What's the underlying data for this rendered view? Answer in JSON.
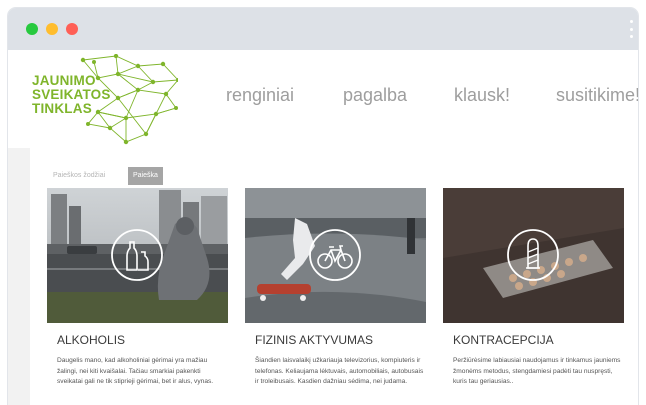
{
  "logo": {
    "line1": "JAUNIMO",
    "line2": "SVEIKATOS",
    "line3": "TINKLAS",
    "color": "#7fb52b"
  },
  "nav": {
    "items": [
      {
        "label": "renginiai"
      },
      {
        "label": "pagalba"
      },
      {
        "label": "klausk!"
      },
      {
        "label": "susitikime!"
      }
    ]
  },
  "tabs": [
    {
      "label": "Paieškos žodžiai",
      "active": false
    },
    {
      "label": "Paieška",
      "active": true
    }
  ],
  "cards": [
    {
      "title": "ALKOHOLIS",
      "icon": "bottles-icon",
      "text": "Daugelis mano, kad alkoholiniai gėrimai yra mažiau žalingi, nei kiti kvaišalai. Tačiau smarkiai pakenkti sveikatai gali ne tik stiprieji gėrimai, bet ir alus, vynas."
    },
    {
      "title": "FIZINIS AKTYVUMAS",
      "icon": "bicycle-icon",
      "text": "Šiandien laisvalaikį užkariauja televizorius, kompiuteris ir telefonas. Keliaujama lėktuvais, automobiliais, autobusais ir troleibusais. Kasdien dažniau sėdima, nei judama."
    },
    {
      "title": "KONTRACEPCIJA",
      "icon": "condom-icon",
      "text": "Peržiūrėsime labiausiai naudojamus ir tinkamus jauniems žmonėms metodus, stengdamiesi padėti tau nuspręsti, kuris tau geriausias.."
    }
  ],
  "colors": {
    "accent": "#7fb52b",
    "chrome": "#dde1e7",
    "nav_text": "#9e9e9e"
  }
}
